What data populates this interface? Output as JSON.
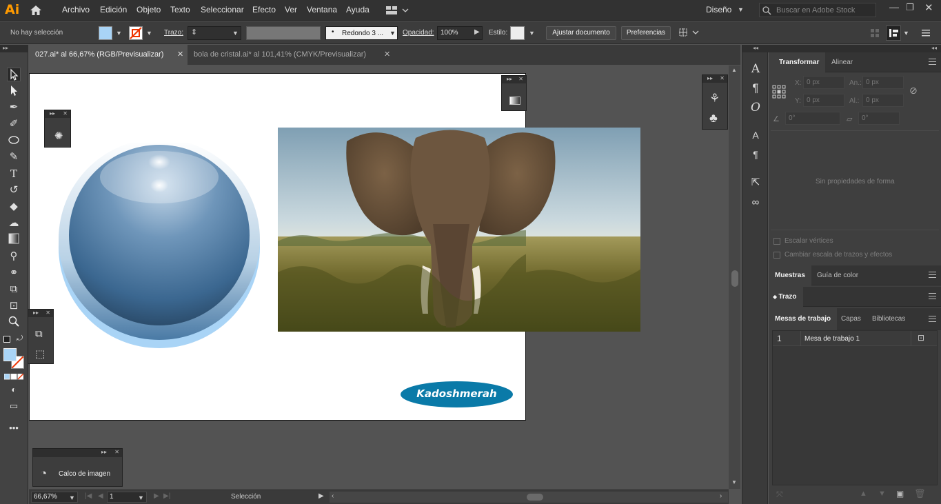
{
  "app": {
    "logo": "Ai",
    "workspace": "Diseño",
    "search_placeholder": "Buscar en Adobe Stock"
  },
  "menu": [
    "Archivo",
    "Edición",
    "Objeto",
    "Texto",
    "Seleccionar",
    "Efecto",
    "Ver",
    "Ventana",
    "Ayuda"
  ],
  "control": {
    "selection_status": "No hay selección",
    "stroke_label": "Trazo:",
    "brush_value": "Redondo 3 ...",
    "opacity_label": "Opacidad:",
    "opacity_value": "100%",
    "style_label": "Estilo:",
    "fit_document": "Ajustar documento",
    "preferences": "Preferencias",
    "fill_color": "#a9d4f6"
  },
  "tabs": [
    {
      "label": "027.ai* al 66,67% (RGB/Previsualizar)",
      "active": true
    },
    {
      "label": "bola de cristal.ai* al 101,41% (CMYK/Previsualizar)",
      "active": false
    }
  ],
  "artwork": {
    "badge_text": "Kadoshmerah",
    "badge_color": "#0a7aa8"
  },
  "float_panels": {
    "trace_label": "Calco de imagen"
  },
  "panels": {
    "transform_tabs": [
      "Transformar",
      "Alinear"
    ],
    "x_label": "X:",
    "y_label": "Y:",
    "w_label": "An.:",
    "h_label": "Al.:",
    "x_value": "0 px",
    "y_value": "0 px",
    "w_value": "0 px",
    "h_value": "0 px",
    "angle_value": "0°",
    "shear_value": "0°",
    "no_shape": "Sin propiedades de forma",
    "scale_corners": "Escalar vértices",
    "scale_strokes": "Cambiar escala de trazos y efectos",
    "swatch_tabs": [
      "Muestras",
      "Guía de color"
    ],
    "stroke_title": "Trazo",
    "artboard_tabs": [
      "Mesas de trabajo",
      "Capas",
      "Bibliotecas"
    ],
    "artboard_row": {
      "index": "1",
      "name": "Mesa de trabajo 1"
    }
  },
  "status": {
    "zoom": "66,67%",
    "page": "1",
    "tool": "Selección"
  },
  "icons": [
    "home-icon",
    "layout-icon",
    "search-icon",
    "selection-tool-icon",
    "direct-selection-icon",
    "pen-tool-icon",
    "type-tool-icon",
    "zoom-tool-icon",
    "close-icon",
    "menu-icon"
  ]
}
